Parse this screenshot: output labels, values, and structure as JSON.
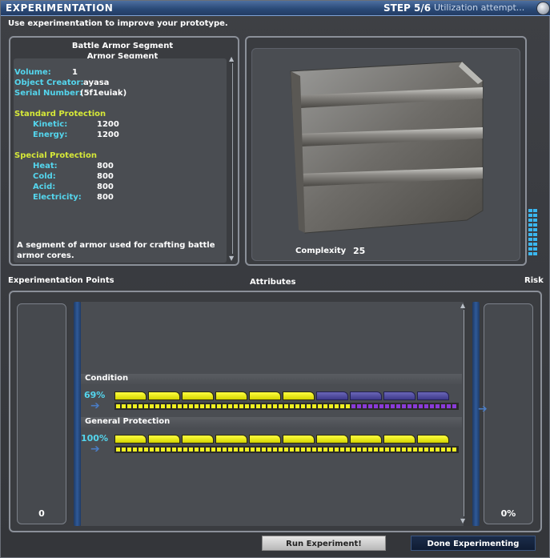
{
  "window": {
    "title": "EXPERIMENTATION",
    "step": "STEP 5/6",
    "step_hint": "Utilization attempt...",
    "close_icon": "close-icon"
  },
  "instructions": "Use experimentation to improve your prototype.",
  "item": {
    "name": "Battle Armor Segment",
    "subname": "Armor Segment",
    "fields": [
      {
        "label": "Volume:",
        "value": "1"
      },
      {
        "label": "Object Creator:",
        "value": "ayasa"
      },
      {
        "label": "Serial Number:",
        "value": "(5f1euiak)"
      }
    ],
    "standard_title": "Standard Protection",
    "standard": [
      {
        "label": "Kinetic:",
        "value": "1200"
      },
      {
        "label": "Energy:",
        "value": "1200"
      }
    ],
    "special_title": "Special Protection",
    "special": [
      {
        "label": "Heat:",
        "value": "800"
      },
      {
        "label": "Cold:",
        "value": "800"
      },
      {
        "label": "Acid:",
        "value": "800"
      },
      {
        "label": "Electricity:",
        "value": "800"
      }
    ],
    "description": "A segment of armor used for crafting battle armor cores."
  },
  "viewer": {
    "complexity_label": "Complexity",
    "complexity_value": "25"
  },
  "labels": {
    "points": "Experimentation Points",
    "attributes": "Attributes",
    "risk": "Risk"
  },
  "points_value": "0",
  "risk_value": "0%",
  "attributes": [
    {
      "name": "Condition",
      "percent_text": "69%",
      "filled_segments": 6,
      "total_segments": 10,
      "dots_fill": 0.69
    },
    {
      "name": "General Protection",
      "percent_text": "100%",
      "filled_segments": 10,
      "total_segments": 10,
      "dots_fill": 1.0
    }
  ],
  "colors": {
    "accent_cyan": "#54d6ee",
    "section_yellow": "#d6e838",
    "bar_yellow": "#f0f020",
    "bar_purple": "#8a3ad8",
    "title_blue": "#2a4a78"
  },
  "buttons": {
    "run": "Run Experiment!",
    "done": "Done Experimenting"
  }
}
